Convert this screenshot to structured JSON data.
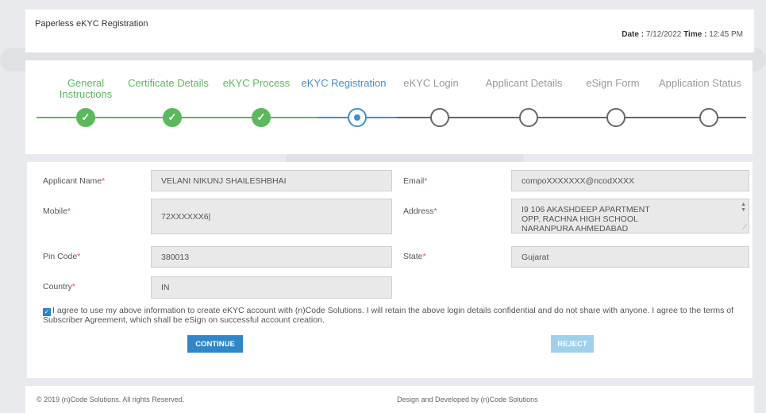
{
  "header": {
    "title": "Paperless eKYC Registration",
    "date_label": "Date :",
    "date_value": "7/12/2022",
    "time_label": "Time :",
    "time_value": "12:45 PM"
  },
  "steps": [
    {
      "label": "General Instructions",
      "status": "done"
    },
    {
      "label": "Certificate Details",
      "status": "done"
    },
    {
      "label": "eKYC Process",
      "status": "done"
    },
    {
      "label": "eKYC Registration",
      "status": "active"
    },
    {
      "label": "eKYC Login",
      "status": "todo"
    },
    {
      "label": "Applicant Details",
      "status": "todo"
    },
    {
      "label": "eSign Form",
      "status": "todo"
    },
    {
      "label": "Application Status",
      "status": "todo"
    }
  ],
  "form": {
    "applicant_name": {
      "label": "Applicant Name",
      "value": "VELANI NIKUNJ SHAILESHBHAI"
    },
    "email": {
      "label": "Email",
      "value": "compoXXXXXXX@ncodXXXX"
    },
    "mobile": {
      "label": "Mobile",
      "value": "72XXXXXX6|"
    },
    "address": {
      "label": "Address",
      "value": "I9 106 AKASHDEEP APARTMENT\nOPP. RACHNA HIGH SCHOOL\nNARANPURA AHMEDABAD"
    },
    "pin_code": {
      "label": "Pin Code",
      "value": "380013"
    },
    "state": {
      "label": "State",
      "value": "Gujarat"
    },
    "country": {
      "label": "Country",
      "value": "IN"
    },
    "required_mark": "*",
    "agree_text": "I agree to use my above information to create eKYC account with (n)Code Solutions. I will retain the above login details confidential and do not share with anyone. I agree to the terms of Subscriber Agreement, which shall be eSign on successful account creation.",
    "continue_label": "CONTINUE",
    "reject_label": "REJECT"
  },
  "footer": {
    "copyright": "© 2019 (n)Code Solutions. All rights Reserved.",
    "credit": "Design and Developed by (n)Code Solutions"
  },
  "colors": {
    "done": "#5cb85c",
    "active": "#3f8fcf",
    "continue_button": "#2f86c9",
    "reject_button": "#9fd0ec"
  }
}
